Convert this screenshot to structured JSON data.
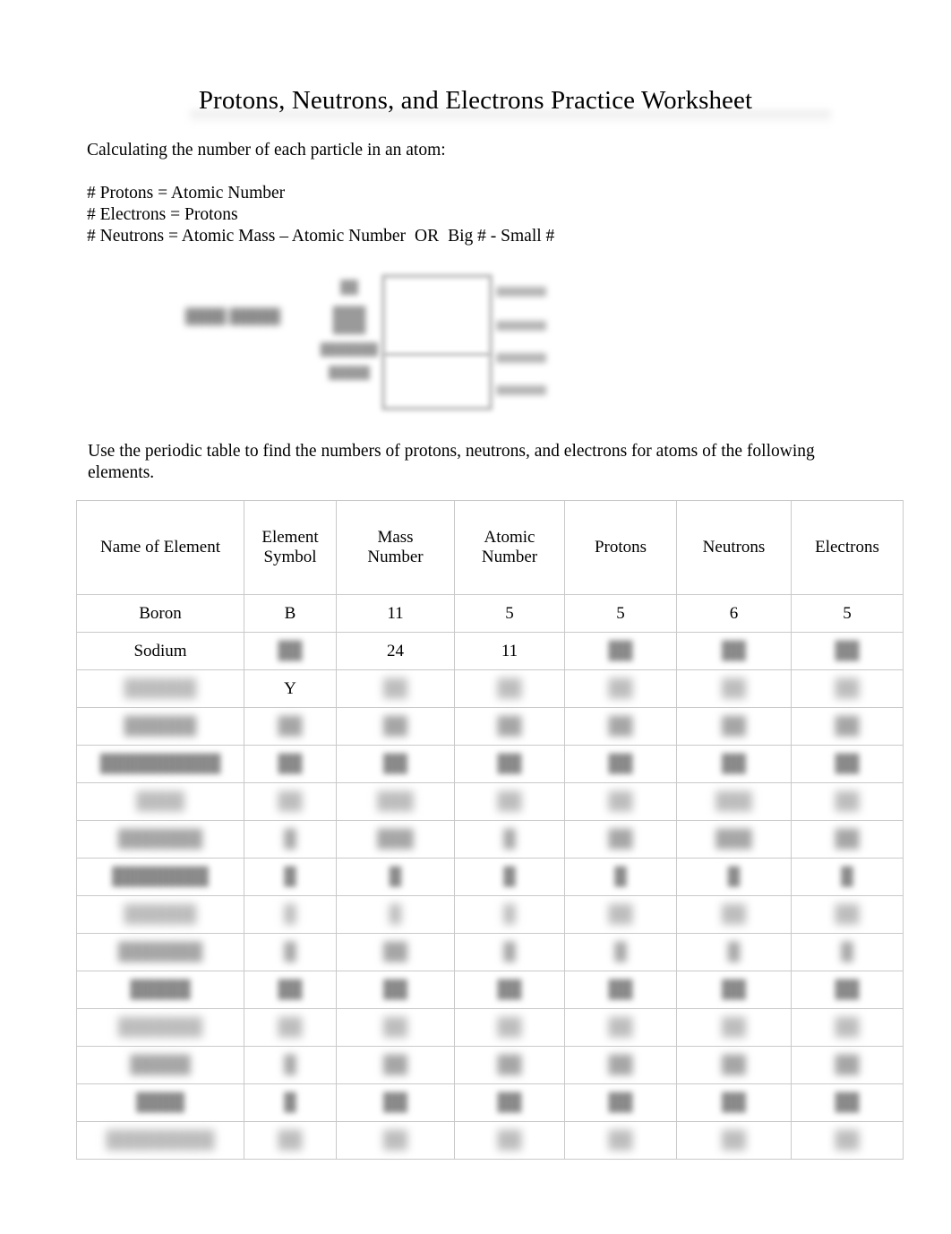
{
  "document": {
    "title": "Protons, Neutrons, and Electrons Practice Worksheet",
    "intro": "Calculating the number of each particle in an atom:",
    "formulas": [
      "# Protons = Atomic Number",
      "# Electrons = Protons",
      "# Neutrons = Atomic Mass – Atomic Number",
      "OR",
      "Big # - Small #"
    ],
    "instruction": "Use the periodic table to find the numbers of protons, neutrons, and electrons for atoms of the following elements."
  },
  "diagram": {
    "left_label": "████ █████",
    "tile": {
      "atomic_number": "██",
      "symbol": "██",
      "name": "███████",
      "mass": "█████"
    },
    "callouts": [
      "███",
      "███",
      "███",
      "███"
    ]
  },
  "table": {
    "headers": [
      "Name of Element",
      "Element Symbol",
      "Mass Number",
      "Atomic Number",
      "Protons",
      "Neutrons",
      "Electrons"
    ],
    "headers_split": [
      [
        "Name of Element"
      ],
      [
        "Element",
        "Symbol"
      ],
      [
        "Mass",
        "Number"
      ],
      [
        "Atomic",
        "Number"
      ],
      [
        "Protons"
      ],
      [
        "Neutrons"
      ],
      [
        "Electrons"
      ]
    ],
    "rows": [
      {
        "name": "Boron",
        "name_legible": true,
        "symbol": "B",
        "symbol_legible": true,
        "mass": "11",
        "mass_legible": true,
        "atomic": "5",
        "atomic_legible": true,
        "protons": "5",
        "protons_legible": true,
        "neutrons": "6",
        "neutrons_legible": true,
        "electrons": "5",
        "electrons_legible": true
      },
      {
        "name": "Sodium",
        "name_legible": true,
        "symbol": "██",
        "symbol_legible": false,
        "mass": "24",
        "mass_legible": true,
        "atomic": "11",
        "atomic_legible": true,
        "protons": "██",
        "protons_legible": false,
        "neutrons": "██",
        "neutrons_legible": false,
        "electrons": "██",
        "electrons_legible": false
      },
      {
        "name": "██████",
        "name_legible": false,
        "symbol": "Y",
        "symbol_legible": true,
        "mass": "██",
        "mass_legible": false,
        "atomic": "██",
        "atomic_legible": false,
        "protons": "██",
        "protons_legible": false,
        "neutrons": "██",
        "neutrons_legible": false,
        "electrons": "██",
        "electrons_legible": false
      },
      {
        "name": "██████",
        "name_legible": false,
        "symbol": "██",
        "symbol_legible": false,
        "mass": "██",
        "mass_legible": false,
        "atomic": "██",
        "atomic_legible": false,
        "protons": "██",
        "protons_legible": false,
        "neutrons": "██",
        "neutrons_legible": false,
        "electrons": "██",
        "electrons_legible": false
      },
      {
        "name": "██████████",
        "name_legible": false,
        "symbol": "██",
        "symbol_legible": false,
        "mass": "██",
        "mass_legible": false,
        "atomic": "██",
        "atomic_legible": false,
        "protons": "██",
        "protons_legible": false,
        "neutrons": "██",
        "neutrons_legible": false,
        "electrons": "██",
        "electrons_legible": false
      },
      {
        "name": "████",
        "name_legible": false,
        "symbol": "██",
        "symbol_legible": false,
        "mass": "███",
        "mass_legible": false,
        "atomic": "██",
        "atomic_legible": false,
        "protons": "██",
        "protons_legible": false,
        "neutrons": "███",
        "neutrons_legible": false,
        "electrons": "██",
        "electrons_legible": false
      },
      {
        "name": "███████",
        "name_legible": false,
        "symbol": "█",
        "symbol_legible": false,
        "mass": "███",
        "mass_legible": false,
        "atomic": "█",
        "atomic_legible": false,
        "protons": "██",
        "protons_legible": false,
        "neutrons": "███",
        "neutrons_legible": false,
        "electrons": "██",
        "electrons_legible": false
      },
      {
        "name": "████████",
        "name_legible": false,
        "symbol": "█",
        "symbol_legible": false,
        "mass": "█",
        "mass_legible": false,
        "atomic": "█",
        "atomic_legible": false,
        "protons": "█",
        "protons_legible": false,
        "neutrons": "█",
        "neutrons_legible": false,
        "electrons": "█",
        "electrons_legible": false
      },
      {
        "name": "██████",
        "name_legible": false,
        "symbol": "█",
        "symbol_legible": false,
        "mass": "█",
        "mass_legible": false,
        "atomic": "█",
        "atomic_legible": false,
        "protons": "██",
        "protons_legible": false,
        "neutrons": "██",
        "neutrons_legible": false,
        "electrons": "██",
        "electrons_legible": false
      },
      {
        "name": "███████",
        "name_legible": false,
        "symbol": "█",
        "symbol_legible": false,
        "mass": "██",
        "mass_legible": false,
        "atomic": "█",
        "atomic_legible": false,
        "protons": "█",
        "protons_legible": false,
        "neutrons": "█",
        "neutrons_legible": false,
        "electrons": "█",
        "electrons_legible": false
      },
      {
        "name": "█████",
        "name_legible": false,
        "symbol": "██",
        "symbol_legible": false,
        "mass": "██",
        "mass_legible": false,
        "atomic": "██",
        "atomic_legible": false,
        "protons": "██",
        "protons_legible": false,
        "neutrons": "██",
        "neutrons_legible": false,
        "electrons": "██",
        "electrons_legible": false
      },
      {
        "name": "███████",
        "name_legible": false,
        "symbol": "██",
        "symbol_legible": false,
        "mass": "██",
        "mass_legible": false,
        "atomic": "██",
        "atomic_legible": false,
        "protons": "██",
        "protons_legible": false,
        "neutrons": "██",
        "neutrons_legible": false,
        "electrons": "██",
        "electrons_legible": false
      },
      {
        "name": "█████",
        "name_legible": false,
        "symbol": "█",
        "symbol_legible": false,
        "mass": "██",
        "mass_legible": false,
        "atomic": "██",
        "atomic_legible": false,
        "protons": "██",
        "protons_legible": false,
        "neutrons": "██",
        "neutrons_legible": false,
        "electrons": "██",
        "electrons_legible": false
      },
      {
        "name": "████",
        "name_legible": false,
        "symbol": "█",
        "symbol_legible": false,
        "mass": "██",
        "mass_legible": false,
        "atomic": "██",
        "atomic_legible": false,
        "protons": "██",
        "protons_legible": false,
        "neutrons": "██",
        "neutrons_legible": false,
        "electrons": "██",
        "electrons_legible": false
      },
      {
        "name": "█████████",
        "name_legible": false,
        "symbol": "██",
        "symbol_legible": false,
        "mass": "██",
        "mass_legible": false,
        "atomic": "██",
        "atomic_legible": false,
        "protons": "██",
        "protons_legible": false,
        "neutrons": "██",
        "neutrons_legible": false,
        "electrons": "██",
        "electrons_legible": false
      }
    ]
  }
}
